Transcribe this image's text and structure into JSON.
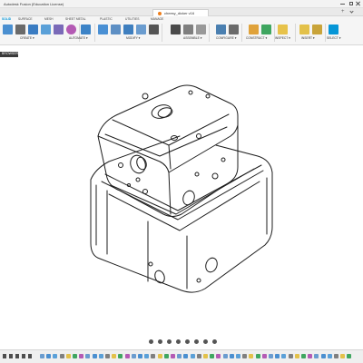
{
  "app": {
    "title": "Autodesk Fusion (Education License)"
  },
  "document_tab": {
    "name": "cheesy_dicker v16"
  },
  "ribbon": {
    "tabs": [
      {
        "label": "SOLID",
        "active": true
      },
      {
        "label": "SURFACE",
        "active": false
      },
      {
        "label": "MESH",
        "active": false
      },
      {
        "label": "SHEET METAL",
        "active": false
      },
      {
        "label": "PLASTIC",
        "active": false
      },
      {
        "label": "UTILITIES",
        "active": false
      },
      {
        "label": "MANAGE",
        "active": false
      }
    ],
    "groups": [
      {
        "label": "CREATE"
      },
      {
        "label": "AUTOMATE"
      },
      {
        "label": "MODIFY"
      },
      {
        "label": "ASSEMBLE"
      },
      {
        "label": "CONFIGURE"
      },
      {
        "label": "CONSTRUCT"
      },
      {
        "label": "INSPECT"
      },
      {
        "label": "INSERT"
      },
      {
        "label": "SELECT"
      }
    ],
    "tool_icons": [
      "new-component-icon",
      "create-sketch-icon",
      "extrude-icon",
      "revolve-icon",
      "hole-icon",
      "form-icon",
      "automate-icon",
      "press-pull-icon",
      "fillet-icon",
      "chamfer-icon",
      "shell-icon",
      "move-icon",
      "new-component-assemble-icon",
      "joint-icon",
      "as-built-joint-icon",
      "configure-table-icon",
      "configure-rule-icon",
      "offset-plane-icon",
      "midplane-icon",
      "measure-icon",
      "insert-mesh-icon",
      "decal-icon",
      "select-icon"
    ]
  },
  "browser": {
    "label": "BROWSER"
  },
  "colors": {
    "accent": "#0696d7",
    "doc_icon": "#ee7d19",
    "ribbon_bg": "#f5f5f5",
    "dark_panel": "#3a3a3a"
  },
  "navigation_bar": {
    "icons": [
      "orbit-icon",
      "pan-icon",
      "look-at-icon",
      "zoom-icon",
      "fit-icon",
      "display-settings-icon",
      "grid-icon",
      "viewports-icon"
    ]
  },
  "timeline": {
    "controls": [
      "first-step-icon",
      "previous-step-icon",
      "play-icon",
      "next-step-icon",
      "last-step-icon"
    ]
  }
}
